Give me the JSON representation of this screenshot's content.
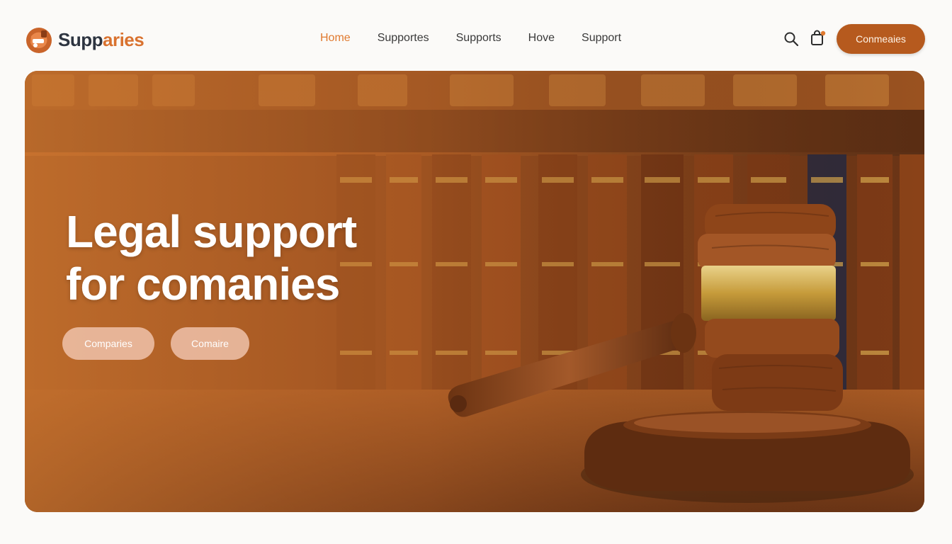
{
  "brand": {
    "name_part1": "Supp",
    "name_part2": "aries",
    "accent": "#d9722f",
    "dark": "#2d3440"
  },
  "nav": {
    "items": [
      {
        "label": "Home",
        "active": true
      },
      {
        "label": "Supportes",
        "active": false
      },
      {
        "label": "Supports",
        "active": false
      },
      {
        "label": "Hove",
        "active": false
      },
      {
        "label": "Support",
        "active": false
      }
    ]
  },
  "header": {
    "cta_label": "Conmeaies",
    "icons": [
      "search-icon",
      "cart-icon"
    ]
  },
  "hero": {
    "title_line1": "Legal support",
    "title_line2": "for comanies",
    "button1": "Comparies",
    "button2": "Comaire",
    "image": "gavel-and-law-books"
  },
  "colors": {
    "cta": "#b65a1e",
    "active_nav": "#e07a2f",
    "hero_button": "#f1c6b0"
  }
}
